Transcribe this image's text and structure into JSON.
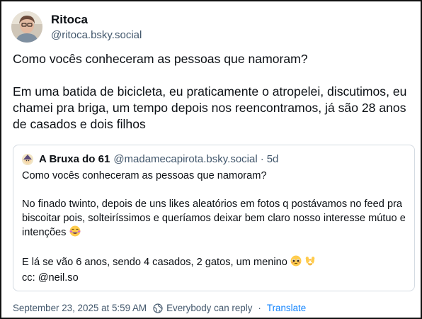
{
  "author": {
    "display_name": "Ritoca",
    "handle": "@ritoca.bsky.social"
  },
  "post": {
    "text": "Como vocês conheceram as pessoas que namoram?\n\nEm uma batida de bicicleta, eu praticamente o atropelei, discutimos, eu chamei pra briga, um tempo depois nos reencontramos, já são 28 anos de casados e dois filhos"
  },
  "quote": {
    "display_name": "A Bruxa do 61",
    "handle": "@madamecapirota.bsky.social",
    "separator": "·",
    "time": "5d",
    "line1": "Como vocês conheceram as pessoas que namoram?",
    "para2": "No finado twinto, depois de uns likes aleatórios em fotos q postávamos no feed pra biscoitar pois, solteiríssimos e queríamos deixar bem claro nosso interesse mútuo e intenções",
    "para3": "E lá se vão 6 anos, sendo 4 casados, 2 gatos, um menino",
    "para4": "cc: @neil.so",
    "emojis": [
      "laughing-with-tears-emoji",
      "pleading-face-emoji",
      "heart-hands-emoji"
    ]
  },
  "footer": {
    "timestamp": "September 23, 2025 at 5:59 AM",
    "reply_setting": "Everybody can reply",
    "separator": "·",
    "translate_label": "Translate"
  },
  "colors": {
    "text": "#0b0f14",
    "muted": "#42576c",
    "link": "#1083fe",
    "border": "#d4dbe2"
  }
}
